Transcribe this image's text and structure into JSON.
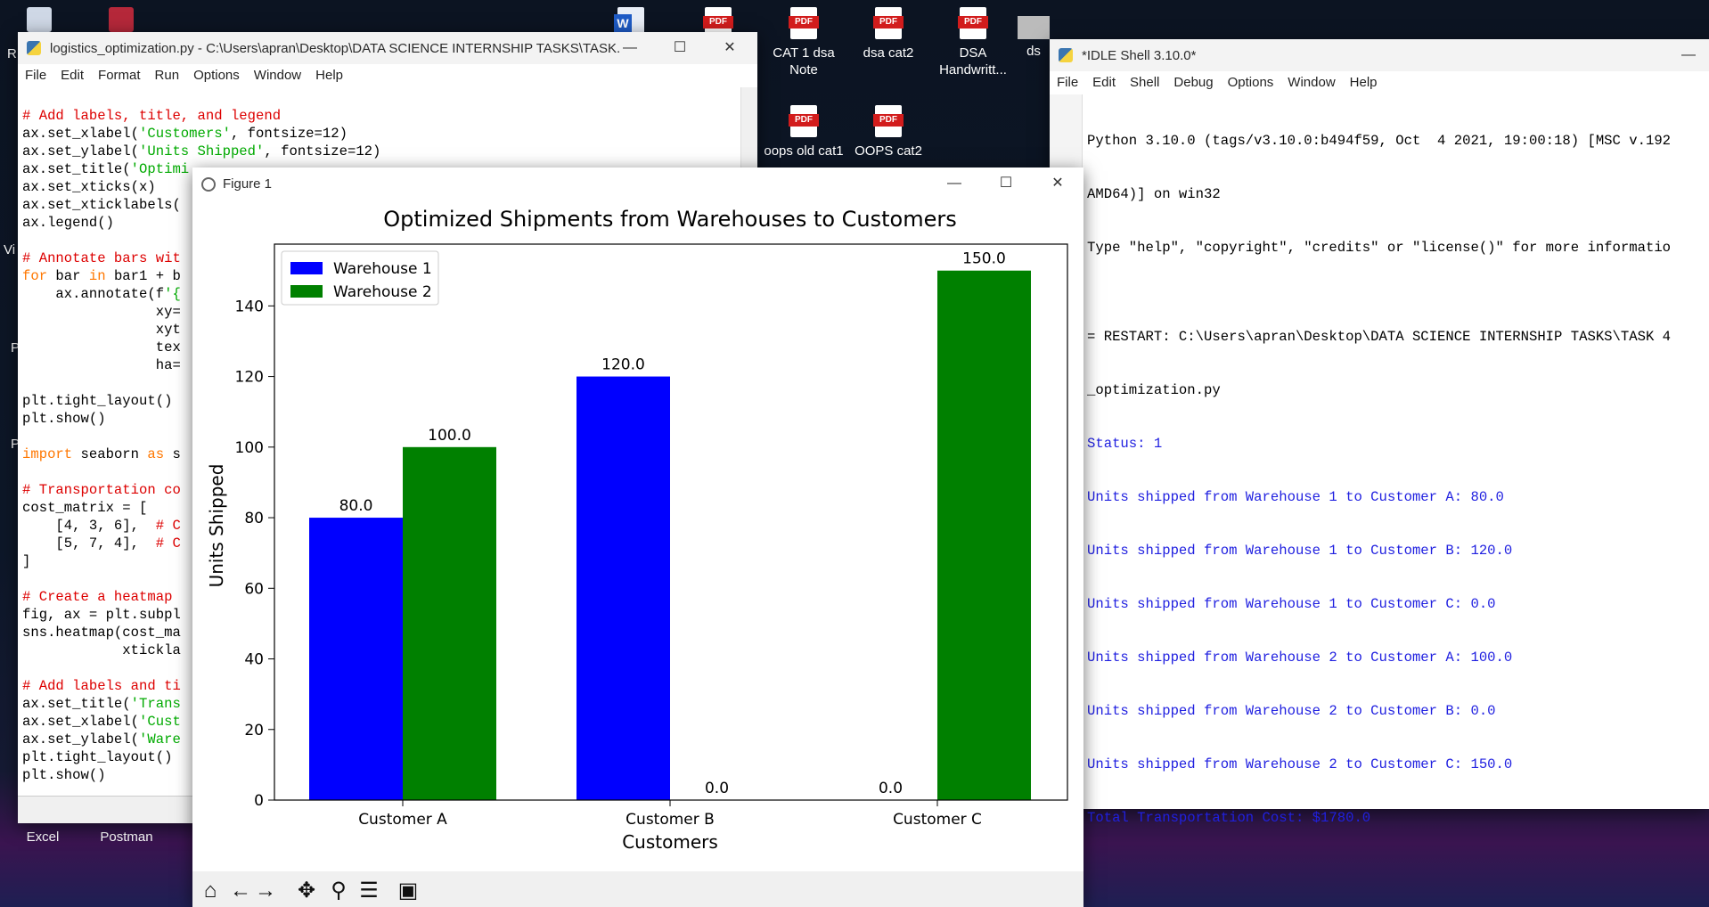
{
  "desktop": {
    "icons": [
      {
        "label": "CAT 1 dsa Note",
        "type": "pdf"
      },
      {
        "label": "dsa cat2",
        "type": "pdf"
      },
      {
        "label": "DSA Handwritt...",
        "type": "pdf"
      },
      {
        "label": "oops old cat1",
        "type": "pdf"
      },
      {
        "label": "OOPS cat2",
        "type": "pdf"
      },
      {
        "label": "Excel",
        "type": "app"
      },
      {
        "label": "Postman",
        "type": "app"
      }
    ],
    "partial_right_label": "ds",
    "left_fragments": [
      "R",
      "Vi",
      "P",
      "P"
    ]
  },
  "editor": {
    "title": "logistics_optimization.py - C:\\Users\\apran\\Desktop\\DATA SCIENCE INTERNSHIP TASKS\\TASK...",
    "menu": [
      "File",
      "Edit",
      "Format",
      "Run",
      "Options",
      "Window",
      "Help"
    ],
    "lines": [
      "# Add labels, title, and legend",
      "ax.set_xlabel('Customers', fontsize=12)",
      "ax.set_ylabel('Units Shipped', fontsize=12)",
      "ax.set_title('Optimi",
      "ax.set_xticks(x)",
      "ax.set_xticklabels(",
      "ax.legend()",
      "",
      "# Annotate bars wit",
      "for bar in bar1 + b",
      "    ax.annotate(f'{",
      "                xy=",
      "                xyt",
      "                tex",
      "                ha=",
      "",
      "plt.tight_layout()",
      "plt.show()",
      "",
      "import seaborn as s",
      "",
      "# Transportation co",
      "cost_matrix = [",
      "    [4, 3, 6],  # C",
      "    [5, 7, 4],  # C",
      "]",
      "",
      "# Create a heatmap",
      "fig, ax = plt.subpl",
      "sns.heatmap(cost_ma",
      "            xtickla",
      "",
      "# Add labels and ti",
      "ax.set_title('Trans",
      "ax.set_xlabel('Cust",
      "ax.set_ylabel('Ware",
      "plt.tight_layout()",
      "plt.show()"
    ]
  },
  "shell": {
    "title": "*IDLE Shell 3.10.0*",
    "menu": [
      "File",
      "Edit",
      "Shell",
      "Debug",
      "Options",
      "Window",
      "Help"
    ],
    "prompt": ">>>",
    "header_lines": [
      "Python 3.10.0 (tags/v3.10.0:b494f59, Oct  4 2021, 19:00:18) [MSC v.192",
      "AMD64)] on win32",
      "Type \"help\", \"copyright\", \"credits\" or \"license()\" for more informatio",
      "",
      "= RESTART: C:\\Users\\apran\\Desktop\\DATA SCIENCE INTERNSHIP TASKS\\TASK 4",
      "_optimization.py"
    ],
    "output_lines": [
      "Status: 1",
      "Units shipped from Warehouse 1 to Customer A: 80.0",
      "Units shipped from Warehouse 1 to Customer B: 120.0",
      "Units shipped from Warehouse 1 to Customer C: 0.0",
      "Units shipped from Warehouse 2 to Customer A: 100.0",
      "Units shipped from Warehouse 2 to Customer B: 0.0",
      "Units shipped from Warehouse 2 to Customer C: 150.0",
      "Total Transportation Cost: $1780.0"
    ]
  },
  "figure": {
    "title": "Figure 1",
    "toolbar": [
      "home-icon",
      "back-icon",
      "forward-icon",
      "pan-icon",
      "zoom-icon",
      "configure-icon",
      "save-icon"
    ]
  },
  "chart_data": {
    "type": "bar",
    "title": "Optimized Shipments from Warehouses to Customers",
    "xlabel": "Customers",
    "ylabel": "Units Shipped",
    "categories": [
      "Customer A",
      "Customer B",
      "Customer C"
    ],
    "series": [
      {
        "name": "Warehouse 1",
        "color": "#0000ff",
        "values": [
          80.0,
          120.0,
          0.0
        ],
        "labels": [
          "80.0",
          "120.0",
          "0.0"
        ]
      },
      {
        "name": "Warehouse 2",
        "color": "#008000",
        "values": [
          100.0,
          0.0,
          150.0
        ],
        "labels": [
          "100.0",
          "0.0",
          "150.0"
        ]
      }
    ],
    "ylim": [
      0,
      157.5
    ],
    "yticks": [
      "0",
      "20",
      "40",
      "60",
      "80",
      "100",
      "120",
      "140"
    ],
    "legend": "upper-left",
    "grid": false
  }
}
